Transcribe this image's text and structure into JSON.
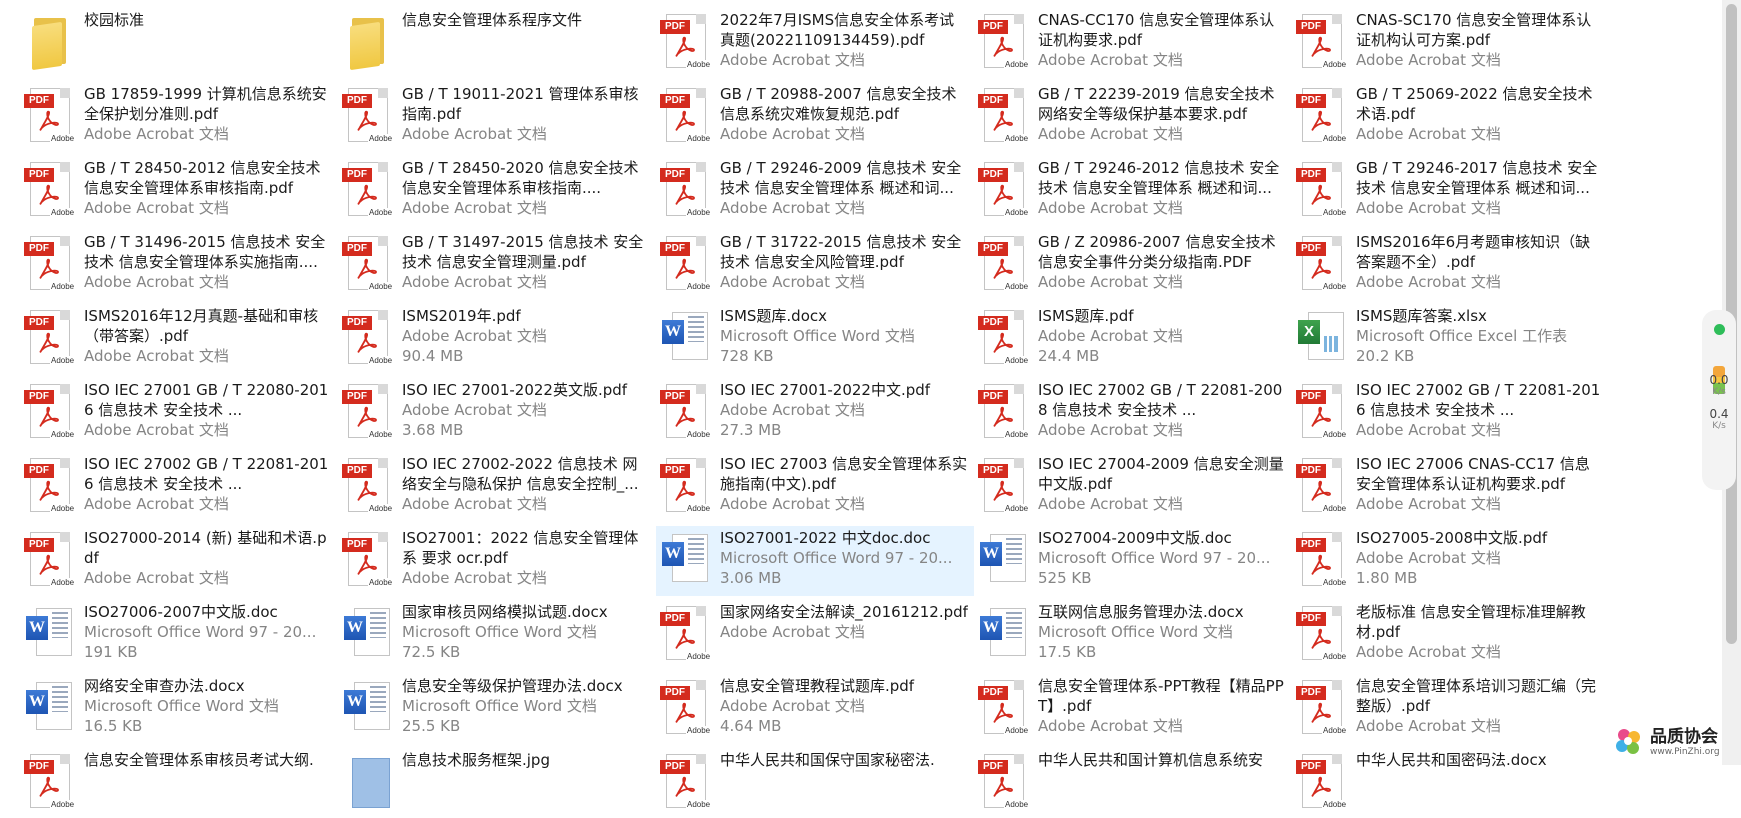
{
  "files": [
    {
      "name": "校园标准",
      "meta": "",
      "size": "",
      "type": "folder"
    },
    {
      "name": "信息安全管理体系程序文件",
      "meta": "",
      "size": "",
      "type": "folder"
    },
    {
      "name": "2022年7月ISMS信息安全体系考试真题(20221109134459).pdf",
      "meta": "Adobe Acrobat 文档",
      "size": "",
      "type": "pdf"
    },
    {
      "name": "CNAS-CC170 信息安全管理体系认证机构要求.pdf",
      "meta": "Adobe Acrobat 文档",
      "size": "",
      "type": "pdf"
    },
    {
      "name": "CNAS-SC170 信息安全管理体系认证机构认可方案.pdf",
      "meta": "Adobe Acrobat 文档",
      "size": "",
      "type": "pdf"
    },
    {
      "name": "GB 17859-1999 计算机信息系统安全保护划分准则.pdf",
      "meta": "Adobe Acrobat 文档",
      "size": "",
      "type": "pdf"
    },
    {
      "name": "GB / T 19011-2021 管理体系审核指南.pdf",
      "meta": "Adobe Acrobat 文档",
      "size": "",
      "type": "pdf"
    },
    {
      "name": "GB / T 20988-2007 信息安全技术 信息系统灾难恢复规范.pdf",
      "meta": "Adobe Acrobat 文档",
      "size": "",
      "type": "pdf"
    },
    {
      "name": "GB / T 22239-2019 信息安全技术 网络安全等级保护基本要求.pdf",
      "meta": "Adobe Acrobat 文档",
      "size": "",
      "type": "pdf"
    },
    {
      "name": "GB / T 25069-2022 信息安全技术 术语.pdf",
      "meta": "Adobe Acrobat 文档",
      "size": "",
      "type": "pdf"
    },
    {
      "name": "GB / T 28450-2012 信息安全技术 信息安全管理体系审核指南.pdf",
      "meta": "Adobe Acrobat 文档",
      "size": "",
      "type": "pdf"
    },
    {
      "name": "GB / T 28450-2020 信息安全技术 信息安全管理体系审核指南....",
      "meta": "Adobe Acrobat 文档",
      "size": "",
      "type": "pdf"
    },
    {
      "name": "GB / T 29246-2009 信息技术 安全技术 信息安全管理体系 概述和词...",
      "meta": "Adobe Acrobat 文档",
      "size": "",
      "type": "pdf"
    },
    {
      "name": "GB / T 29246-2012 信息技术 安全技术 信息安全管理体系 概述和词...",
      "meta": "Adobe Acrobat 文档",
      "size": "",
      "type": "pdf"
    },
    {
      "name": "GB / T 29246-2017 信息技术 安全技术 信息安全管理体系 概述和词...",
      "meta": "Adobe Acrobat 文档",
      "size": "",
      "type": "pdf"
    },
    {
      "name": "GB / T 31496-2015 信息技术 安全技术 信息安全管理体系实施指南....",
      "meta": "Adobe Acrobat 文档",
      "size": "",
      "type": "pdf"
    },
    {
      "name": "GB / T 31497-2015 信息技术 安全技术 信息安全管理测量.pdf",
      "meta": "Adobe Acrobat 文档",
      "size": "",
      "type": "pdf"
    },
    {
      "name": "GB / T 31722-2015 信息技术 安全技术 信息安全风险管理.pdf",
      "meta": "Adobe Acrobat 文档",
      "size": "",
      "type": "pdf"
    },
    {
      "name": "GB / Z 20986-2007 信息安全技术 信息安全事件分类分级指南.PDF",
      "meta": "Adobe Acrobat 文档",
      "size": "",
      "type": "pdf"
    },
    {
      "name": "ISMS2016年6月考题审核知识（缺答案题不全）.pdf",
      "meta": "Adobe Acrobat 文档",
      "size": "",
      "type": "pdf"
    },
    {
      "name": "ISMS2016年12月真题-基础和审核（带答案）.pdf",
      "meta": "Adobe Acrobat 文档",
      "size": "",
      "type": "pdf"
    },
    {
      "name": "ISMS2019年.pdf",
      "meta": "Adobe Acrobat 文档",
      "size": "90.4 MB",
      "type": "pdf"
    },
    {
      "name": "ISMS题库.docx",
      "meta": "Microsoft Office Word 文档",
      "size": "728 KB",
      "type": "docx"
    },
    {
      "name": "ISMS题库.pdf",
      "meta": "Adobe Acrobat 文档",
      "size": "24.4 MB",
      "type": "pdf"
    },
    {
      "name": "ISMS题库答案.xlsx",
      "meta": "Microsoft Office Excel 工作表",
      "size": "20.2 KB",
      "type": "xlsx"
    },
    {
      "name": "ISO IEC 27001 GB / T 22080-2016 信息技术 安全技术 ...",
      "meta": "Adobe Acrobat 文档",
      "size": "",
      "type": "pdf"
    },
    {
      "name": "ISO IEC 27001-2022英文版.pdf",
      "meta": "Adobe Acrobat 文档",
      "size": "3.68 MB",
      "type": "pdf"
    },
    {
      "name": "ISO IEC 27001-2022中文.pdf",
      "meta": "Adobe Acrobat 文档",
      "size": "27.3 MB",
      "type": "pdf"
    },
    {
      "name": "ISO IEC 27002 GB / T 22081-2008 信息技术 安全技术 ...",
      "meta": "Adobe Acrobat 文档",
      "size": "",
      "type": "pdf"
    },
    {
      "name": "ISO IEC 27002 GB / T 22081-2016 信息技术 安全技术 ...",
      "meta": "Adobe Acrobat 文档",
      "size": "",
      "type": "pdf"
    },
    {
      "name": "ISO IEC 27002 GB / T 22081-2016 信息技术 安全技术 ...",
      "meta": "Adobe Acrobat 文档",
      "size": "",
      "type": "pdf"
    },
    {
      "name": "ISO IEC 27002-2022 信息技术 网络安全与隐私保护 信息安全控制_...",
      "meta": "Adobe Acrobat 文档",
      "size": "",
      "type": "pdf"
    },
    {
      "name": "ISO IEC 27003 信息安全管理体系实施指南(中文).pdf",
      "meta": "Adobe Acrobat 文档",
      "size": "",
      "type": "pdf"
    },
    {
      "name": "ISO IEC 27004-2009 信息安全测量中文版.pdf",
      "meta": "Adobe Acrobat 文档",
      "size": "",
      "type": "pdf"
    },
    {
      "name": "ISO IEC 27006 CNAS-CC17 信息安全管理体系认证机构要求.pdf",
      "meta": "Adobe Acrobat 文档",
      "size": "",
      "type": "pdf"
    },
    {
      "name": "ISO27000-2014 (新) 基础和术语.pdf",
      "meta": "Adobe Acrobat 文档",
      "size": "",
      "type": "pdf"
    },
    {
      "name": "ISO27001：2022 信息安全管理体系 要求 ocr.pdf",
      "meta": "Adobe Acrobat 文档",
      "size": "",
      "type": "pdf"
    },
    {
      "name": "ISO27001-2022 中文doc.doc",
      "meta": "Microsoft Office Word 97 - 20...",
      "size": "3.06 MB",
      "type": "doc",
      "selected": true
    },
    {
      "name": "ISO27004-2009中文版.doc",
      "meta": "Microsoft Office Word 97 - 20...",
      "size": "525 KB",
      "type": "doc"
    },
    {
      "name": "ISO27005-2008中文版.pdf",
      "meta": "Adobe Acrobat 文档",
      "size": "1.80 MB",
      "type": "pdf"
    },
    {
      "name": "ISO27006-2007中文版.doc",
      "meta": "Microsoft Office Word 97 - 20...",
      "size": "191 KB",
      "type": "doc"
    },
    {
      "name": "国家审核员网络模拟试题.docx",
      "meta": "Microsoft Office Word 文档",
      "size": "72.5 KB",
      "type": "docx"
    },
    {
      "name": "国家网络安全法解读_20161212.pdf",
      "meta": "Adobe Acrobat 文档",
      "size": "",
      "type": "pdf"
    },
    {
      "name": "互联网信息服务管理办法.docx",
      "meta": "Microsoft Office Word 文档",
      "size": "17.5 KB",
      "type": "docx"
    },
    {
      "name": "老版标准 信息安全管理标准理解教材.pdf",
      "meta": "Adobe Acrobat 文档",
      "size": "",
      "type": "pdf"
    },
    {
      "name": "网络安全审查办法.docx",
      "meta": "Microsoft Office Word 文档",
      "size": "16.5 KB",
      "type": "docx"
    },
    {
      "name": "信息安全等级保护管理办法.docx",
      "meta": "Microsoft Office Word 文档",
      "size": "25.5 KB",
      "type": "docx"
    },
    {
      "name": "信息安全管理教程试题库.pdf",
      "meta": "Adobe Acrobat 文档",
      "size": "4.64 MB",
      "type": "pdf"
    },
    {
      "name": "信息安全管理体系-PPT教程【精品PPT】.pdf",
      "meta": "Adobe Acrobat 文档",
      "size": "",
      "type": "pdf"
    },
    {
      "name": "信息安全管理体系培训习题汇编（完整版）.pdf",
      "meta": "Adobe Acrobat 文档",
      "size": "",
      "type": "pdf"
    },
    {
      "name": "信息安全管理体系审核员考试大纲.",
      "meta": "",
      "size": "",
      "type": "pdf"
    },
    {
      "name": "信息技术服务框架.jpg",
      "meta": "",
      "size": "",
      "type": "jpg"
    },
    {
      "name": "中华人民共和国保守国家秘密法.",
      "meta": "",
      "size": "",
      "type": "pdf"
    },
    {
      "name": "中华人民共和国计算机信息系统安",
      "meta": "",
      "size": "",
      "type": "pdf"
    },
    {
      "name": "中华人民共和国密码法.docx",
      "meta": "",
      "size": "",
      "type": "pdf"
    }
  ],
  "icons": {
    "pdf": "pdf-file-icon",
    "doc": "word-file-icon",
    "docx": "word-file-icon",
    "xlsx": "excel-file-icon",
    "folder": "folder-icon",
    "jpg": "image-file-icon"
  },
  "pdf_icon": {
    "tag": "PDF",
    "brand": "Adobe"
  },
  "word_icon": {
    "letter": "W"
  },
  "excel_icon": {
    "letter": "X"
  },
  "side_widget": {
    "upload_speed": "0.0",
    "upload_unit": "K/s",
    "download_speed": "0.4",
    "download_unit": "K/s",
    "status_color": "#2ebd59"
  },
  "brand": {
    "name": "品质协会",
    "url": "www.PinZhi.org"
  },
  "colors": {
    "selected_bg": "#e5f3ff",
    "meta_text": "#858585",
    "pdf_red": "#d42b1e"
  }
}
